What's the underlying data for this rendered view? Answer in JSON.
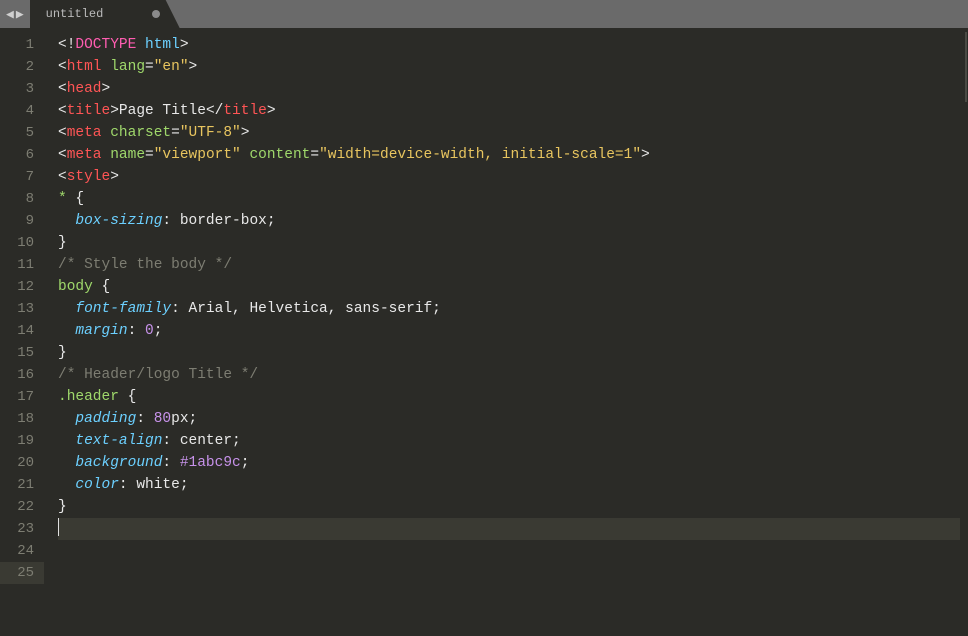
{
  "tab": {
    "title": "untitled",
    "dirty": true
  },
  "nav": {
    "left": "◀",
    "right": "▶",
    "divider": "|"
  },
  "gutter": {
    "start": 1,
    "end": 25,
    "active": 25
  },
  "code": {
    "lines": [
      [
        {
          "c": "c-punct",
          "t": "<!"
        },
        {
          "c": "c-doctype",
          "t": "DOCTYPE"
        },
        {
          "c": "c-punct",
          "t": " "
        },
        {
          "c": "c-tag2",
          "t": "html"
        },
        {
          "c": "c-punct",
          "t": ">"
        }
      ],
      [
        {
          "c": "c-punct",
          "t": "<"
        },
        {
          "c": "c-tag",
          "t": "html"
        },
        {
          "c": "c-punct",
          "t": " "
        },
        {
          "c": "c-attr",
          "t": "lang"
        },
        {
          "c": "c-punct",
          "t": "="
        },
        {
          "c": "c-string",
          "t": "\"en\""
        },
        {
          "c": "c-punct",
          "t": ">"
        }
      ],
      [
        {
          "c": "c-punct",
          "t": "<"
        },
        {
          "c": "c-tag",
          "t": "head"
        },
        {
          "c": "c-punct",
          "t": ">"
        }
      ],
      [
        {
          "c": "c-punct",
          "t": "<"
        },
        {
          "c": "c-tag",
          "t": "title"
        },
        {
          "c": "c-punct",
          "t": ">"
        },
        {
          "c": "c-white",
          "t": "Page Title"
        },
        {
          "c": "c-punct",
          "t": "</"
        },
        {
          "c": "c-tag",
          "t": "title"
        },
        {
          "c": "c-punct",
          "t": ">"
        }
      ],
      [
        {
          "c": "c-punct",
          "t": "<"
        },
        {
          "c": "c-tag",
          "t": "meta"
        },
        {
          "c": "c-punct",
          "t": " "
        },
        {
          "c": "c-attr",
          "t": "charset"
        },
        {
          "c": "c-punct",
          "t": "="
        },
        {
          "c": "c-string",
          "t": "\"UTF-8\""
        },
        {
          "c": "c-punct",
          "t": ">"
        }
      ],
      [
        {
          "c": "c-punct",
          "t": "<"
        },
        {
          "c": "c-tag",
          "t": "meta"
        },
        {
          "c": "c-punct",
          "t": " "
        },
        {
          "c": "c-attr",
          "t": "name"
        },
        {
          "c": "c-punct",
          "t": "="
        },
        {
          "c": "c-string",
          "t": "\"viewport\""
        },
        {
          "c": "c-punct",
          "t": " "
        },
        {
          "c": "c-attr",
          "t": "content"
        },
        {
          "c": "c-punct",
          "t": "="
        },
        {
          "c": "c-string",
          "t": "\"width=device-width, initial-scale=1\""
        },
        {
          "c": "c-punct",
          "t": ">"
        }
      ],
      [
        {
          "c": "c-punct",
          "t": "<"
        },
        {
          "c": "c-tag",
          "t": "style"
        },
        {
          "c": "c-punct",
          "t": ">"
        }
      ],
      [
        {
          "c": "c-selector",
          "t": "*"
        },
        {
          "c": "c-punct",
          "t": " {"
        }
      ],
      [
        {
          "c": "c-guide",
          "t": "  "
        },
        {
          "c": "c-prop",
          "t": "box-sizing"
        },
        {
          "c": "c-punct",
          "t": ": "
        },
        {
          "c": "c-value",
          "t": "border-box"
        },
        {
          "c": "c-punct",
          "t": ";"
        }
      ],
      [
        {
          "c": "c-punct",
          "t": "}"
        }
      ],
      [
        {
          "c": "c-punct",
          "t": ""
        }
      ],
      [
        {
          "c": "c-comment",
          "t": "/* Style the body */"
        }
      ],
      [
        {
          "c": "c-selector",
          "t": "body"
        },
        {
          "c": "c-punct",
          "t": " {"
        }
      ],
      [
        {
          "c": "c-guide",
          "t": "  "
        },
        {
          "c": "c-prop",
          "t": "font-family"
        },
        {
          "c": "c-punct",
          "t": ": "
        },
        {
          "c": "c-value",
          "t": "Arial, Helvetica, sans-serif"
        },
        {
          "c": "c-punct",
          "t": ";"
        }
      ],
      [
        {
          "c": "c-guide",
          "t": "  "
        },
        {
          "c": "c-prop",
          "t": "margin"
        },
        {
          "c": "c-punct",
          "t": ": "
        },
        {
          "c": "c-number",
          "t": "0"
        },
        {
          "c": "c-punct",
          "t": ";"
        }
      ],
      [
        {
          "c": "c-punct",
          "t": "}"
        }
      ],
      [
        {
          "c": "c-punct",
          "t": ""
        }
      ],
      [
        {
          "c": "c-comment",
          "t": "/* Header/logo Title */"
        }
      ],
      [
        {
          "c": "c-selclass",
          "t": ".header"
        },
        {
          "c": "c-punct",
          "t": " {"
        }
      ],
      [
        {
          "c": "c-guide",
          "t": "  "
        },
        {
          "c": "c-prop",
          "t": "padding"
        },
        {
          "c": "c-punct",
          "t": ": "
        },
        {
          "c": "c-number",
          "t": "80"
        },
        {
          "c": "c-value",
          "t": "px"
        },
        {
          "c": "c-punct",
          "t": ";"
        }
      ],
      [
        {
          "c": "c-guide",
          "t": "  "
        },
        {
          "c": "c-prop",
          "t": "text-align"
        },
        {
          "c": "c-punct",
          "t": ": "
        },
        {
          "c": "c-value",
          "t": "center"
        },
        {
          "c": "c-punct",
          "t": ";"
        }
      ],
      [
        {
          "c": "c-guide",
          "t": "  "
        },
        {
          "c": "c-prop",
          "t": "background"
        },
        {
          "c": "c-punct",
          "t": ": "
        },
        {
          "c": "c-number",
          "t": "#1abc9c"
        },
        {
          "c": "c-punct",
          "t": ";"
        }
      ],
      [
        {
          "c": "c-guide",
          "t": "  "
        },
        {
          "c": "c-prop",
          "t": "color"
        },
        {
          "c": "c-punct",
          "t": ": "
        },
        {
          "c": "c-value",
          "t": "white"
        },
        {
          "c": "c-punct",
          "t": ";"
        }
      ],
      [
        {
          "c": "c-punct",
          "t": "}"
        }
      ],
      [
        {
          "c": "",
          "t": ""
        }
      ]
    ]
  }
}
